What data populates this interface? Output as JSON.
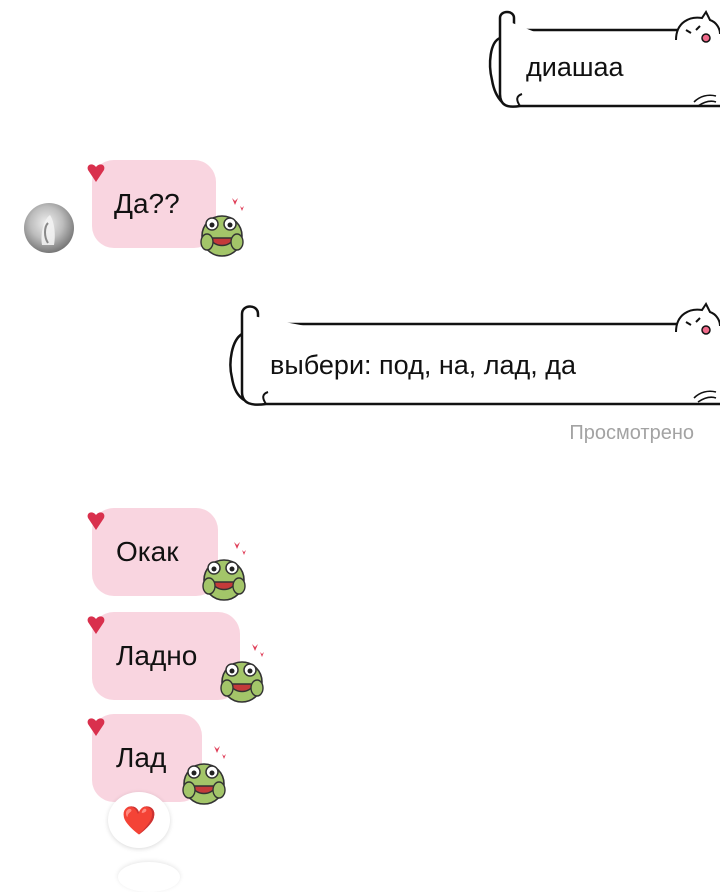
{
  "messages": {
    "out_1": "диашаа",
    "in_1": "Да??",
    "out_2": "выбери: под, на, лад, да",
    "seen_label": "Просмотрено",
    "in_2": "Окак",
    "in_3": "Ладно",
    "in_4": "Лад"
  },
  "reaction": {
    "emoji": "❤️"
  },
  "colors": {
    "incoming_bubble": "#f9d5e0",
    "heart": "#e21b3c",
    "seen_text": "#a3a3a3"
  },
  "icons": [
    "avatar",
    "heart-corner-icon",
    "frog-sticker-icon",
    "cat-doodle-icon",
    "heart-reaction-icon"
  ]
}
